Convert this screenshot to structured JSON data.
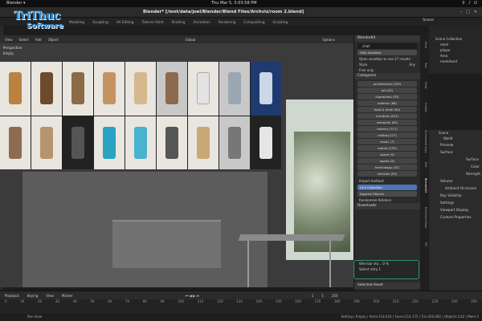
{
  "os_bar": {
    "activities": "Blender ▾",
    "clock": "Thu Mar 5, 5:03:58 PM"
  },
  "window": {
    "title": "Blender* [/mnt/data/joel/Blender/Blend Files/Archviz/room 2.blend]",
    "scene": "Scene"
  },
  "logo": {
    "line1": "TriThuc",
    "line2": "Software"
  },
  "workspace_tabs": [
    "Modeling",
    "Sculpting",
    "UV Editing",
    "Texture Paint",
    "Shading",
    "Animation",
    "Rendering",
    "Compositing",
    "Scripting"
  ],
  "viewport_header": {
    "menu": [
      "View",
      "Select",
      "Add",
      "Object"
    ],
    "orientation": "Global",
    "options": "Options"
  },
  "viewport_labels": {
    "perspective": "Perspective",
    "collection": "Empty"
  },
  "npanel": {
    "addon_title": "BlenderKit",
    "search_value": "chair",
    "hide_label": "Hide Assetbar",
    "search_info": "Open assetbar to see 27 results",
    "style_label": "Style",
    "style_value": "Any",
    "free_only": "Free only",
    "categories_title": "Categories",
    "categories": [
      "architecture (333)",
      "art (43)",
      "characters (32)",
      "exterior (88)",
      "food & drink (90)",
      "furniture (451)",
      "industrial (62)",
      "interior (717)",
      "military (27)",
      "music (7)",
      "nature (133)",
      "space (9)",
      "sports (5)",
      "technology (42)",
      "vehicles (55)"
    ],
    "import_title": "Import method:",
    "import_options": [
      "Link Collection",
      "Append Objects"
    ],
    "randomize": "Randomize Rotation",
    "downloads_title": "Downloads",
    "download_item": "Wire bar sto...   0 %",
    "download_item2": "Select retry       1",
    "selected_asset": "Selected Asset"
  },
  "vtabs": [
    "Item",
    "Tool",
    "View",
    "Create",
    "Screencast Keys",
    "Edit",
    "BlenderKit",
    "Extended Tools",
    "MT"
  ],
  "outliner": {
    "title": "Scene Collection",
    "items": [
      "room",
      "player",
      "Area",
      "roomAsset"
    ]
  },
  "props": {
    "scene": "Scene",
    "world": "World",
    "sections": [
      "Preview",
      "Surface",
      "Volume",
      "Ray Visibility",
      "Settings",
      "Viewport Display",
      "Custom Properties"
    ],
    "surface_labels": [
      "Surface",
      "Color",
      "Strength"
    ],
    "volume_value": "Ambient Occlusion"
  },
  "timeline": {
    "menu": [
      "Playback",
      "Keying",
      "View",
      "Marker"
    ],
    "current": "1",
    "start": "1",
    "end": "250",
    "ruler": [
      "0",
      "10",
      "20",
      "30",
      "40",
      "50",
      "60",
      "70",
      "80",
      "90",
      "100",
      "110",
      "120",
      "130",
      "140",
      "150",
      "160",
      "170",
      "180",
      "190",
      "200",
      "210",
      "220",
      "230",
      "240",
      "250"
    ]
  },
  "status": {
    "left": "Pan View",
    "right": "Setting | Empty | Verts:114,416 | Faces:214,175 | Tris:420,082 | Objects:1/42 | Mem:2"
  }
}
